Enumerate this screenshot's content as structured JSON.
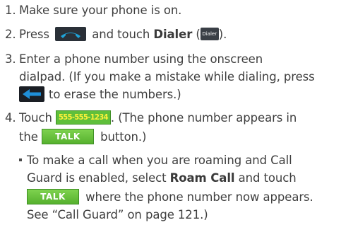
{
  "step1": {
    "number": "1.",
    "text": "Make sure your phone is on."
  },
  "step2": {
    "number": "2.",
    "text_before": "Press",
    "text_middle": "and touch",
    "dialer_bold": "Dialer",
    "paren_open": "(",
    "dialer_icon_label": "Dialer",
    "paren_close": ")."
  },
  "step3": {
    "number": "3.",
    "line1": "Enter a phone number using the onscreen",
    "line2": "dialpad. (If you make a mistake while dialing, press",
    "line3": "to erase the numbers.)"
  },
  "step4": {
    "number": "4.",
    "text_before": "Touch",
    "phone_number": "555-555-1234",
    "text_after": ". (The phone number appears in",
    "line2_before": "the",
    "talk_label": "TALK",
    "line2_after": "button.)"
  },
  "sub_bullet": {
    "line1": "To make a call when you are roaming and Call",
    "line2_before": "Guard is enabled, select",
    "roam_bold": "Roam Call",
    "line2_after": "and touch",
    "talk_label": "TALK",
    "line3_after": "where the phone number now appears.",
    "line4": "See “Call Guard” on page 121.)"
  },
  "icons": {
    "phone": "phone-handset-icon",
    "back": "backspace-arrow-icon",
    "dialer": "dialer-icon"
  },
  "colors": {
    "text": "#3f3f3f",
    "green_button": "#5fbf3b",
    "number_text": "#fff23a",
    "phone_icon_handset": "#1fa3d8",
    "back_arrow": "#1f8fd8"
  }
}
